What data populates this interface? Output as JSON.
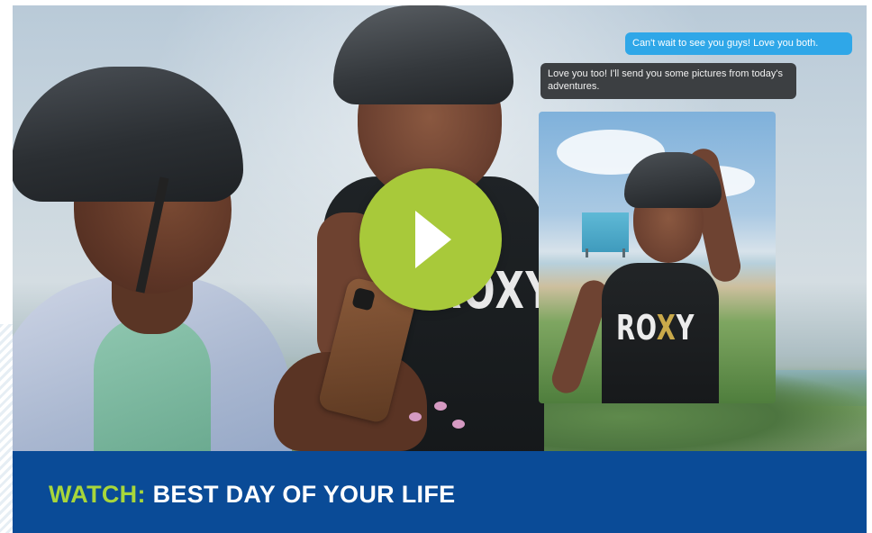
{
  "video": {
    "chat": {
      "outgoing_message": "Can't wait to see you guys! Love you both.",
      "incoming_message": "Love you too! I'll send you some pictures from today's adventures."
    },
    "shirt_text": "ROXY",
    "shirt_text_photo_part1": "RO",
    "shirt_text_photo_part2": "X",
    "shirt_text_photo_part3": "Y",
    "play_icon": "play-icon"
  },
  "caption": {
    "prefix": "WATCH:",
    "title": "BEST DAY OF YOUR LIFE"
  },
  "colors": {
    "play_button": "#a8c93a",
    "caption_background": "#0a4b97",
    "caption_prefix": "#a8d63b",
    "outgoing_bubble": "#2fa7e8",
    "incoming_bubble": "#3c3f42"
  }
}
